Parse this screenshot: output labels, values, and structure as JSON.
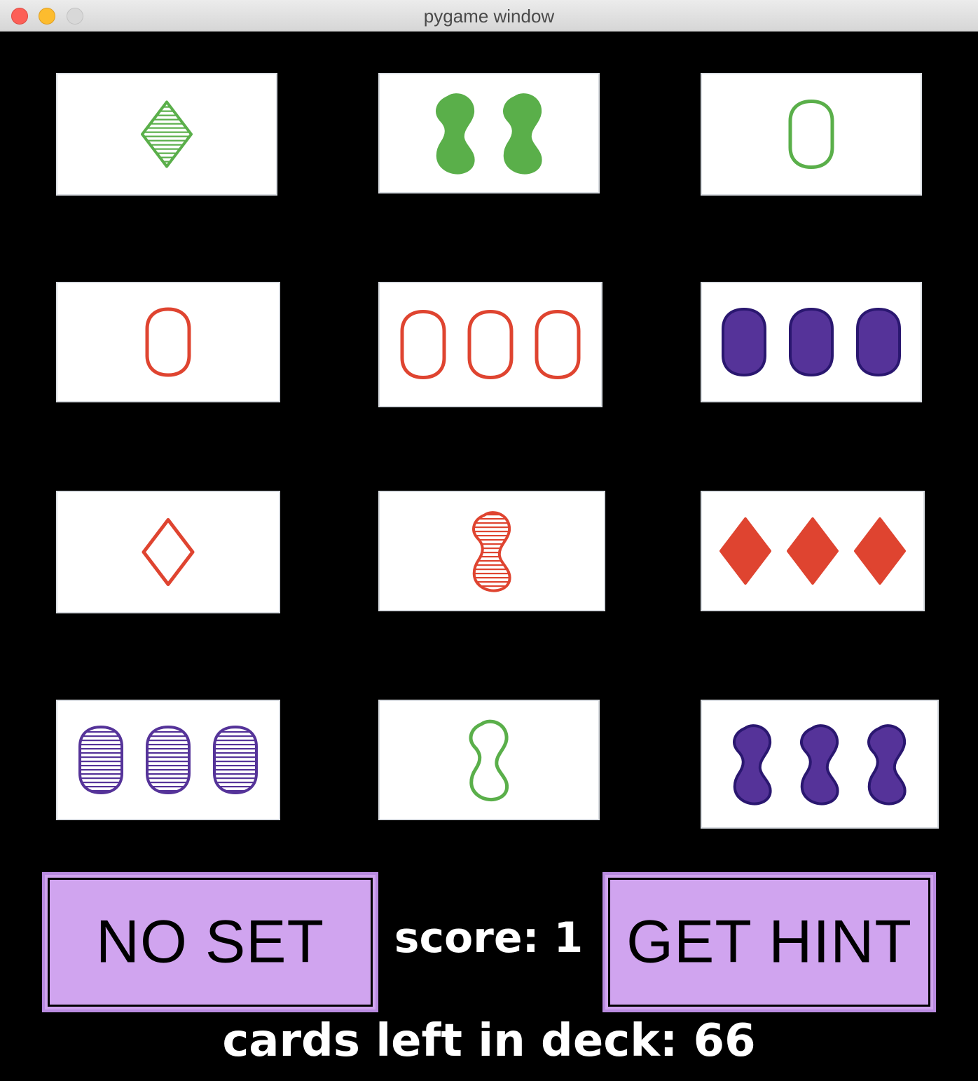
{
  "window": {
    "title": "pygame window"
  },
  "colors": {
    "green": "#5aaf4a",
    "red": "#df4430",
    "purple": "#553399",
    "button": "#d0a4ef"
  },
  "cards": [
    {
      "count": 1,
      "shape": "diamond",
      "color": "green",
      "shading": "striped"
    },
    {
      "count": 2,
      "shape": "squiggle",
      "color": "green",
      "shading": "solid"
    },
    {
      "count": 1,
      "shape": "oval",
      "color": "green",
      "shading": "outline"
    },
    {
      "count": 1,
      "shape": "oval",
      "color": "red",
      "shading": "outline"
    },
    {
      "count": 3,
      "shape": "oval",
      "color": "red",
      "shading": "outline"
    },
    {
      "count": 3,
      "shape": "oval",
      "color": "purple",
      "shading": "solid"
    },
    {
      "count": 1,
      "shape": "diamond",
      "color": "red",
      "shading": "outline"
    },
    {
      "count": 1,
      "shape": "squiggle",
      "color": "red",
      "shading": "striped"
    },
    {
      "count": 3,
      "shape": "diamond",
      "color": "red",
      "shading": "solid"
    },
    {
      "count": 3,
      "shape": "oval",
      "color": "purple",
      "shading": "striped"
    },
    {
      "count": 1,
      "shape": "squiggle",
      "color": "green",
      "shading": "outline"
    },
    {
      "count": 3,
      "shape": "squiggle",
      "color": "purple",
      "shading": "solid"
    }
  ],
  "buttons": {
    "no_set": "NO SET",
    "get_hint": "GET HINT"
  },
  "score_text": "score: 1",
  "deck_text": "cards left in deck: 66"
}
